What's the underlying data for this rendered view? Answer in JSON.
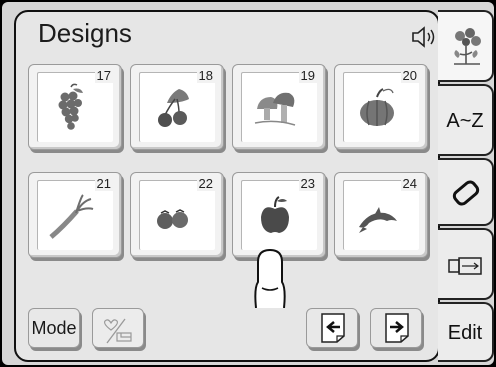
{
  "title": "Designs",
  "designs": [
    {
      "number": "17",
      "icon": "grapes-icon"
    },
    {
      "number": "18",
      "icon": "cherries-icon"
    },
    {
      "number": "19",
      "icon": "mushrooms-icon"
    },
    {
      "number": "20",
      "icon": "pumpkin-icon"
    },
    {
      "number": "21",
      "icon": "leek-icon"
    },
    {
      "number": "22",
      "icon": "tomatoes-icon"
    },
    {
      "number": "23",
      "icon": "apple-icon"
    },
    {
      "number": "24",
      "icon": "dolphin-icon"
    }
  ],
  "bottom": {
    "mode_label": "Mode",
    "favorite_icon": "heart-folder-icon",
    "prev_icon": "page-back-icon",
    "next_icon": "page-forward-icon"
  },
  "side_tabs": {
    "designs_icon": "flower-design-icon",
    "alphabet_label": "A~Z",
    "eraser_icon": "eraser-icon",
    "usb_icon": "usb-memory-icon",
    "edit_label": "Edit"
  },
  "speaker_icon": "speaker-icon",
  "colors": {
    "panel": "#e6e6e6",
    "tile": "#f2f2f2",
    "motif": "#6b6b6b"
  }
}
